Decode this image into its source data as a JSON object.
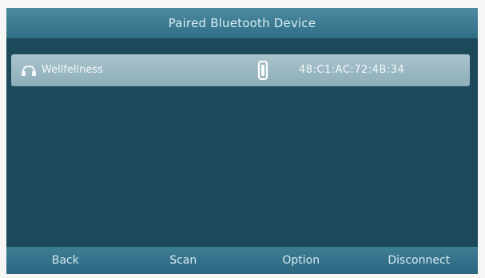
{
  "screen": {
    "title": "Paired Bluetooth Device"
  },
  "devices": [
    {
      "name": "Wellfellness",
      "mac": "48:C1:AC:72:4B:34",
      "icon": "headset-icon",
      "status_icon": "connected-icon"
    }
  ],
  "softkeys": {
    "back": "Back",
    "scan": "Scan",
    "option": "Option",
    "disconnect": "Disconnect"
  },
  "colors": {
    "screen_bg": "#1d4a5b",
    "title_bar": "#3a7a91",
    "selected_row": "#9db8c2",
    "text": "#d9eef5"
  }
}
